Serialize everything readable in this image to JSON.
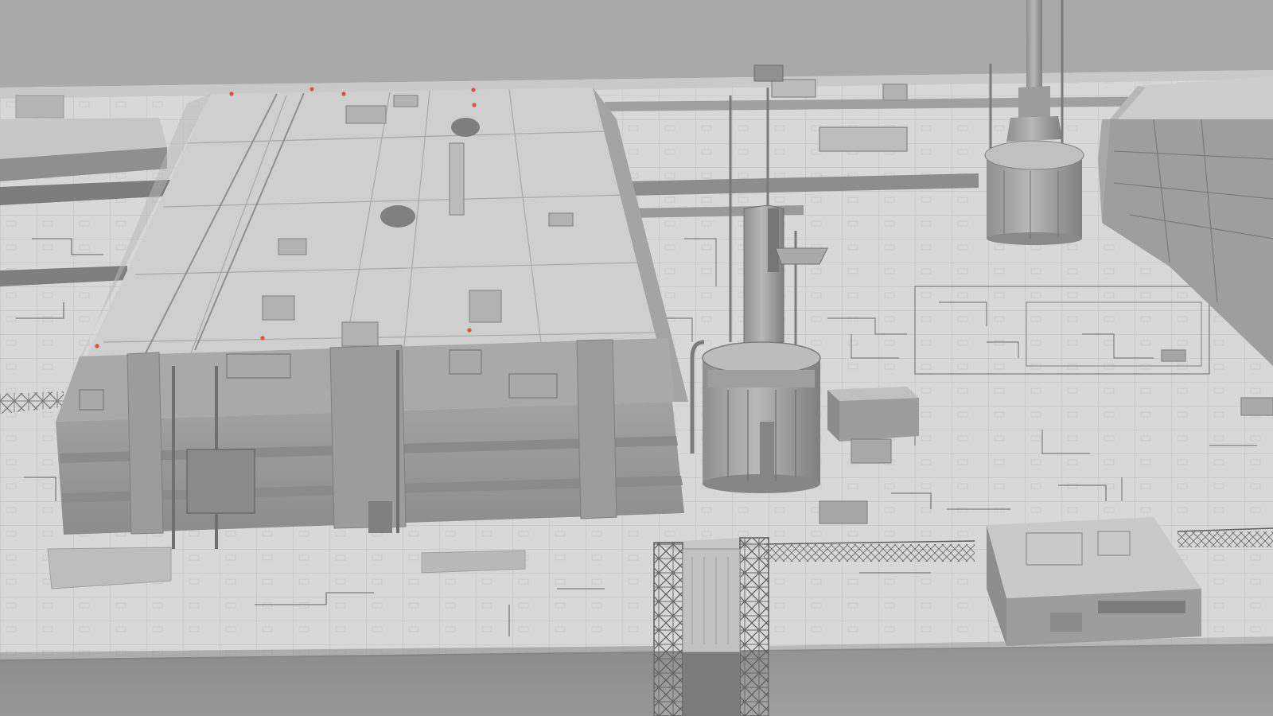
{
  "scene": {
    "kind": "grey-clay 3D render of a sci-fi industrial deck",
    "colors": {
      "sky": "#a7a7a7",
      "deck": "#d9d9d9",
      "deck_shadow": "#bdbdbd",
      "block_top": "#cfcfcf",
      "block_wall": "#9a9a9a",
      "block_wall_dark": "#8a8a8a",
      "panel_line": "#9d9d9d",
      "edge_shadow": "#7a7a7a",
      "warning_light": "#e0523a"
    }
  }
}
